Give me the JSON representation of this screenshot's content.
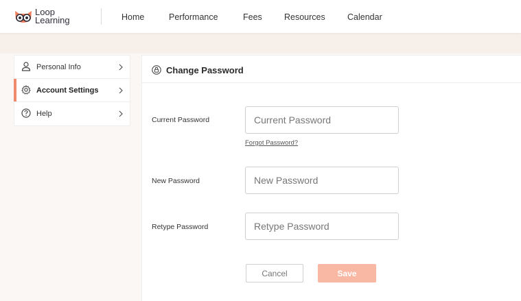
{
  "app": {
    "logo_line1": "Loop",
    "logo_line2": "Learning"
  },
  "nav": {
    "items": [
      {
        "label": "Home"
      },
      {
        "label": "Performance"
      },
      {
        "label": "Fees"
      },
      {
        "label": "Resources"
      },
      {
        "label": "Calendar"
      }
    ]
  },
  "sidebar": {
    "items": [
      {
        "label": "Personal Info",
        "icon": "user-icon",
        "active": false
      },
      {
        "label": "Account Settings",
        "icon": "gear-icon",
        "active": true
      },
      {
        "label": "Help",
        "icon": "help-icon",
        "active": false
      }
    ]
  },
  "panel": {
    "title": "Change Password",
    "icon": "lock-icon",
    "fields": [
      {
        "label": "Current Password",
        "placeholder": "Current Password",
        "value": ""
      },
      {
        "label": "New Password",
        "placeholder": "New Password",
        "value": ""
      },
      {
        "label": "Retype Password",
        "placeholder": "Retype Password",
        "value": ""
      }
    ],
    "forgot_link": "Forgot Password?",
    "cancel_label": "Cancel",
    "save_label": "Save"
  },
  "colors": {
    "accent": "#f08a6c",
    "save_button": "#f8b8a4",
    "background": "#fbf7f4"
  }
}
